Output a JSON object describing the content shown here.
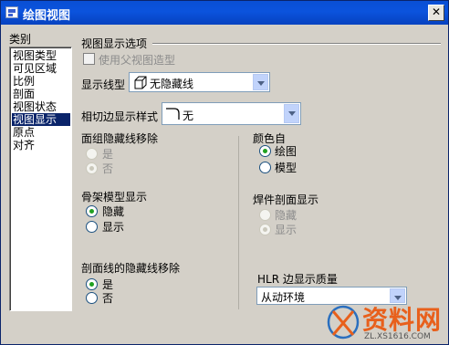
{
  "window": {
    "title": "绘图视图",
    "close_glyph": "✕"
  },
  "categories": {
    "label": "类别",
    "items": [
      "视图类型",
      "可见区域",
      "比例",
      "剖面",
      "视图状态",
      "视图显示",
      "原点",
      "对齐"
    ],
    "selected_index": 5
  },
  "view_display": {
    "header": "视图显示选项",
    "use_parent": {
      "label": "使用父视图造型",
      "checked": false,
      "enabled": false
    },
    "display_style": {
      "label": "显示线型",
      "value": "无隐藏线"
    },
    "tangent_edge": {
      "label": "相切边显示样式",
      "value": "无"
    }
  },
  "face_hidden_removal": {
    "label": "面组隐藏线移除",
    "options": [
      "是",
      "否"
    ],
    "selected": "否",
    "enabled": false
  },
  "color_from": {
    "label": "颜色自",
    "options": [
      "绘图",
      "模型"
    ],
    "selected": "绘图"
  },
  "skeleton_display": {
    "label": "骨架模型显示",
    "options": [
      "隐藏",
      "显示"
    ],
    "selected": "隐藏"
  },
  "weld_section_display": {
    "label": "焊件剖面显示",
    "options": [
      "隐藏",
      "显示"
    ],
    "selected": "显示",
    "enabled": false
  },
  "section_hidden_removal": {
    "label": "剖面线的隐藏线移除",
    "options": [
      "是",
      "否"
    ],
    "selected": "是"
  },
  "hlr_quality": {
    "label": "HLR 边显示质量",
    "value": "从动环境"
  },
  "watermark": {
    "text": "资料网",
    "url": "ZL.XS1616.COM"
  }
}
